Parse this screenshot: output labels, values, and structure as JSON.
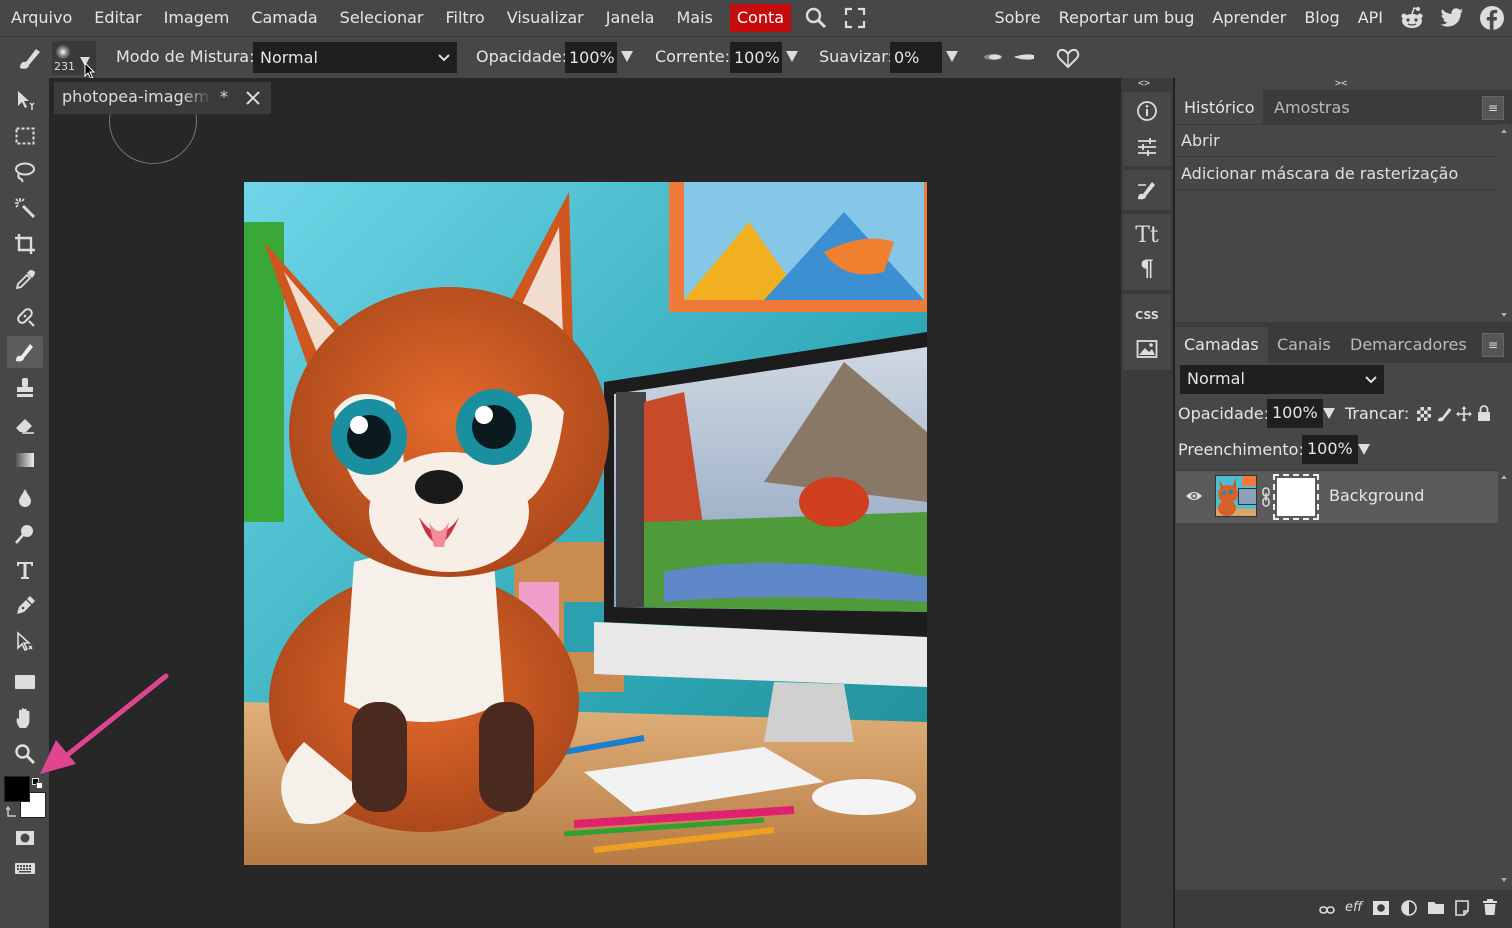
{
  "menu": {
    "items": [
      "Arquivo",
      "Editar",
      "Imagem",
      "Camada",
      "Selecionar",
      "Filtro",
      "Visualizar",
      "Janela",
      "Mais"
    ],
    "account": "Conta",
    "right_links": [
      "Sobre",
      "Reportar um bug",
      "Aprender",
      "Blog",
      "API"
    ],
    "social_icons": [
      "reddit-icon",
      "twitter-icon",
      "facebook-icon"
    ]
  },
  "options": {
    "brush_size": "231",
    "blend_label": "Modo de Mistura:",
    "blend_value": "Normal",
    "opacity_label": "Opacidade:",
    "opacity_value": "100%",
    "flow_label": "Corrente:",
    "flow_value": "100%",
    "smooth_label": "Suavizar:",
    "smooth_value": "0%"
  },
  "document": {
    "tab_title": "photopea-imagem-e",
    "tab_modified": "*"
  },
  "history_panel": {
    "tabs": [
      "Histórico",
      "Amostras"
    ],
    "entries": [
      "Abrir",
      "Adicionar máscara de rasterização"
    ]
  },
  "layers_panel": {
    "tabs": [
      "Camadas",
      "Canais",
      "Demarcadores"
    ],
    "blend_value": "Normal",
    "opacity_label": "Opacidade:",
    "opacity_value": "100%",
    "lock_label": "Trancar:",
    "fill_label": "Preenchimento:",
    "fill_value": "100%",
    "layers": [
      {
        "name": "Background"
      }
    ]
  },
  "iconcol": {
    "css_label": "CSS"
  },
  "colors": {
    "accent": "#c50b0b",
    "foreground": "#000000",
    "background": "#ffffff",
    "annotation_arrow": "#e0468f"
  }
}
